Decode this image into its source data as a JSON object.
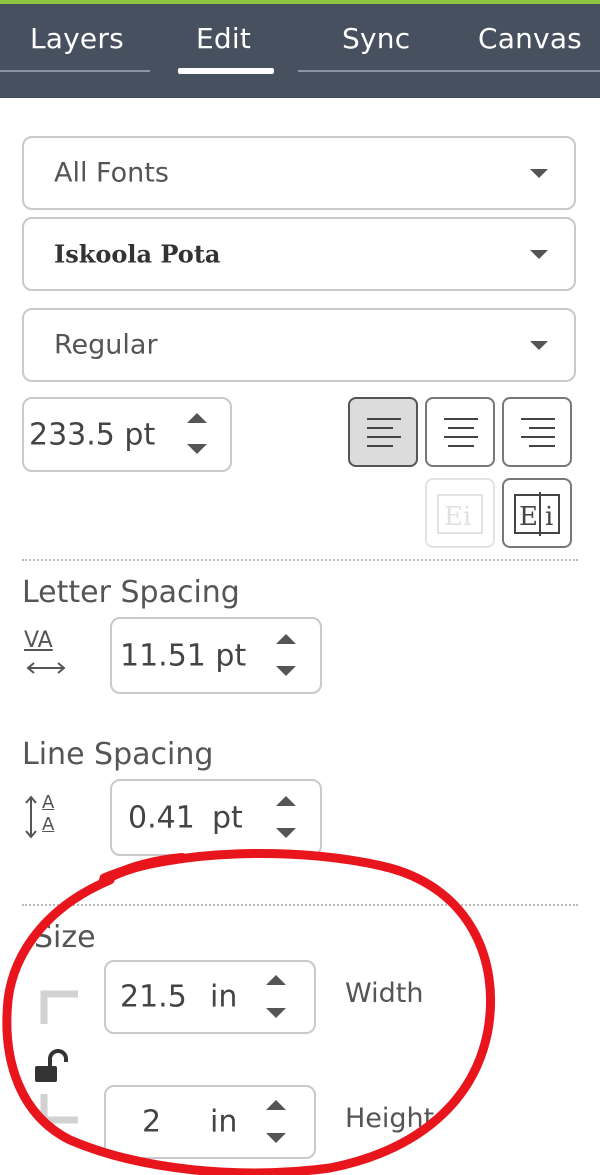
{
  "tabs": [
    {
      "label": "Layers",
      "active": false
    },
    {
      "label": "Edit",
      "active": true
    },
    {
      "label": "Sync",
      "active": false
    },
    {
      "label": "Canvas",
      "active": false
    }
  ],
  "font_filter": {
    "value": "All Fonts"
  },
  "font_family": {
    "value": "Iskoola Pota"
  },
  "font_style": {
    "value": "Regular"
  },
  "font_size": {
    "value": "233.5 pt"
  },
  "alignment": {
    "options": [
      "align-left",
      "align-center",
      "align-right"
    ],
    "selected": "align-left"
  },
  "letter_spacing": {
    "label": "Letter Spacing",
    "icon_text": "VA",
    "value": "11.51 pt"
  },
  "line_spacing": {
    "label": "Line Spacing",
    "icon_text": "A",
    "value": "0.41",
    "unit": "pt"
  },
  "size": {
    "label": "Size",
    "width": {
      "value": "21.5",
      "unit": "in",
      "label": "Width"
    },
    "height": {
      "value": "2",
      "unit": "in",
      "label": "Height"
    }
  },
  "annotation": {
    "color": "#e8161c",
    "shape": "hand-drawn circle"
  },
  "colors": {
    "tab_bar": "#47505e",
    "accent": "#8cc63f"
  }
}
